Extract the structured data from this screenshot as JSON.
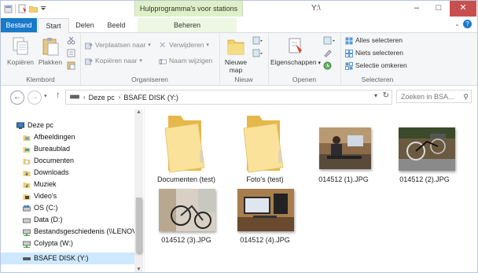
{
  "window": {
    "title": "Y:\\",
    "context_tab_header": "Hulpprogramma's voor stations"
  },
  "tabs": {
    "file": "Bestand",
    "start": "Start",
    "share": "Delen",
    "view": "Beeld",
    "manage": "Beheren"
  },
  "ribbon": {
    "clipboard": {
      "copy": "Kopiëren",
      "paste": "Plakken",
      "label": "Klembord"
    },
    "organize": {
      "move_to": "Verplaatsen naar",
      "copy_to": "Kopiëren naar",
      "delete": "Verwijderen",
      "rename": "Naam wijzigen",
      "label": "Organiseren"
    },
    "new": {
      "new_folder": "Nieuwe map",
      "label": "Nieuw"
    },
    "open": {
      "properties": "Eigenschappen",
      "label": "Openen"
    },
    "select": {
      "select_all": "Alles selecteren",
      "select_none": "Niets selecteren",
      "invert": "Selectie omkeren",
      "label": "Selecteren"
    }
  },
  "address": {
    "segments": [
      "Deze pc",
      "BSAFE DISK (Y:)"
    ],
    "search_placeholder": "Zoeken in BSA..."
  },
  "nav": {
    "items": [
      {
        "label": "Deze pc",
        "icon": "computer-icon"
      },
      {
        "label": "Afbeeldingen",
        "icon": "pictures-folder-icon"
      },
      {
        "label": "Bureaublad",
        "icon": "desktop-folder-icon"
      },
      {
        "label": "Documenten",
        "icon": "documents-folder-icon"
      },
      {
        "label": "Downloads",
        "icon": "downloads-folder-icon"
      },
      {
        "label": "Muziek",
        "icon": "music-folder-icon"
      },
      {
        "label": "Video's",
        "icon": "videos-folder-icon"
      },
      {
        "label": "OS (C:)",
        "icon": "drive-icon"
      },
      {
        "label": "Data (D:)",
        "icon": "drive-icon"
      },
      {
        "label": "Bestandsgeschiedenis (\\\\LENOVO",
        "icon": "network-drive-icon"
      },
      {
        "label": "Colypta (W:)",
        "icon": "network-drive-icon"
      },
      {
        "label": "BSAFE DISK (Y:)",
        "icon": "usb-drive-icon"
      }
    ]
  },
  "files": [
    {
      "name": "Documenten (test)",
      "type": "folder"
    },
    {
      "name": "Foto's (test)",
      "type": "folder"
    },
    {
      "name": "014512 (1).JPG",
      "type": "image"
    },
    {
      "name": "014512 (2).JPG",
      "type": "image"
    },
    {
      "name": "014512 (3).JPG",
      "type": "image"
    },
    {
      "name": "014512 (4).JPG",
      "type": "image"
    }
  ],
  "colors": {
    "file_tab": "#1979ca",
    "context_tab": "#dff0c8",
    "selection": "#cde8ff",
    "folder": "#f2cf6b"
  }
}
